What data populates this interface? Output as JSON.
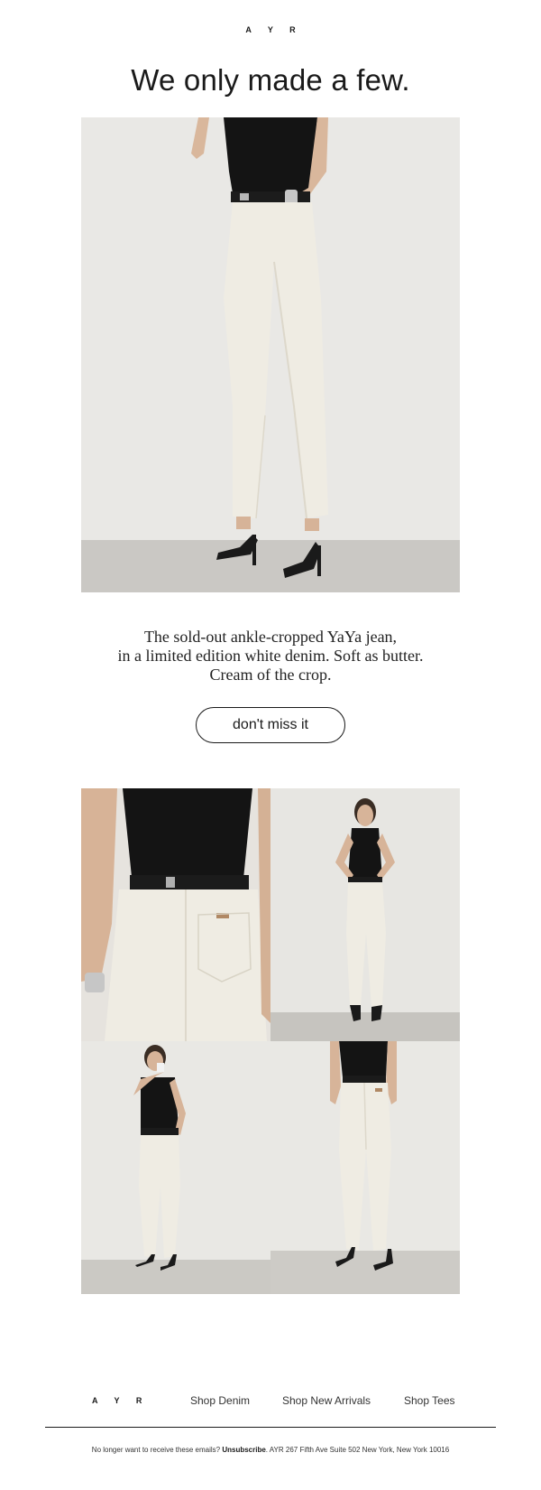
{
  "brand": {
    "logo": "A Y R"
  },
  "headline": "We only made a few.",
  "hero_image": {
    "subject": "model-in-white-jeans-and-black-tank-hero"
  },
  "body_copy": {
    "line1": "The sold-out ankle-cropped YaYa jean,",
    "line2": "in a limited edition white denim. Soft as butter.",
    "line3": "Cream of the crop."
  },
  "cta": {
    "label": "don't miss it"
  },
  "gallery": [
    {
      "subject": "back-pocket-closeup"
    },
    {
      "subject": "full-length-front-hands-on-hips"
    },
    {
      "subject": "full-length-front-drinking"
    },
    {
      "subject": "full-length-back"
    }
  ],
  "footer": {
    "logo": "A Y R",
    "links": [
      "Shop Denim",
      "Shop New Arrivals",
      "Shop Tees"
    ],
    "legal_prefix": "No longer want to receive these emails? ",
    "unsubscribe": "Unsubscribe",
    "legal_suffix": ". AYR 267 Fifth Ave Suite 502 New York, New York 10016"
  },
  "colors": {
    "background": "#ffffff",
    "text": "#1a1a1a",
    "photo_wall": "#e9e8e5",
    "photo_floor": "#c9c7c3",
    "denim_white": "#efece3",
    "tank_black": "#141414"
  }
}
